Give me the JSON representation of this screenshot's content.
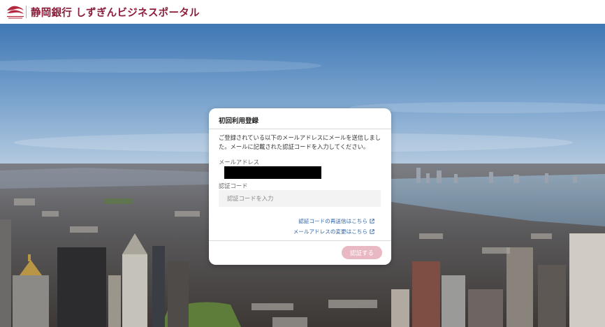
{
  "header": {
    "brand": "静岡銀行 しずぎんビジネスポータル",
    "logo_icon": "shizuoka-bank-logo-icon",
    "brand_color": "#8b1e3b"
  },
  "modal": {
    "title": "初回利用登録",
    "description": "ご登録されている以下のメールアドレスにメールを送信しました。メールに記載された認証コードを入力してください。",
    "email_label": "メールアドレス",
    "code_label": "認証コード",
    "code_placeholder": "認証コードを入力",
    "code_value": "",
    "resend_link": "認証コードの再送信はこちら",
    "change_email_link": "メールアドレスの変更はこちら",
    "link_icon": "external-link-icon",
    "submit_label": "認証する",
    "link_color": "#2e63a8",
    "submit_color": "#e9b9c3"
  }
}
